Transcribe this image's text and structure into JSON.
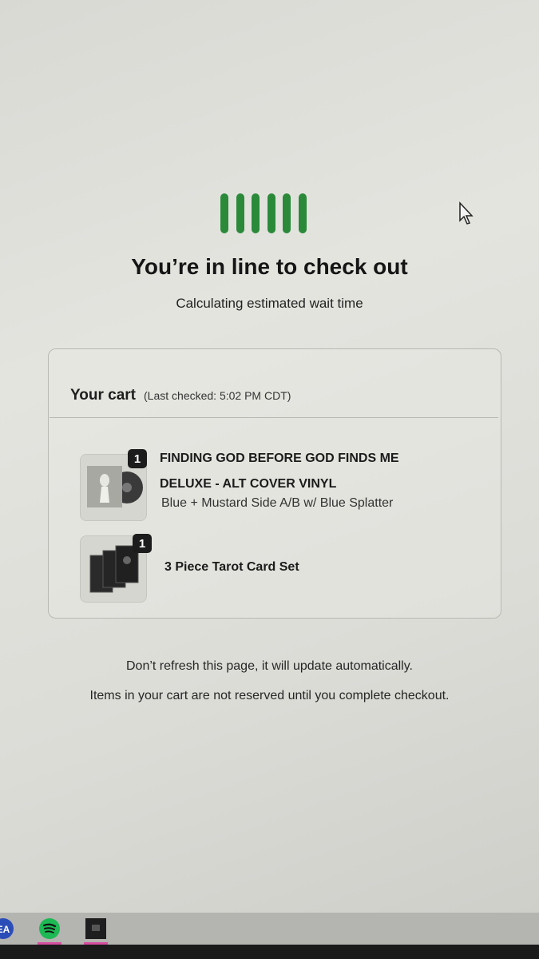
{
  "queue": {
    "title": "You’re in line to check out",
    "subtitle": "Calculating estimated wait time",
    "accent_color": "#2a8a3a",
    "icon": "queue-bars-icon"
  },
  "cart": {
    "title": "Your cart",
    "last_checked": "(Last checked: 5:02 PM CDT)",
    "items": [
      {
        "quantity": "1",
        "name_line1": "FINDING GOD BEFORE GOD FINDS ME",
        "name_line2": "DELUXE - ALT COVER VINYL",
        "variant": "Blue + Mustard Side A/B w/ Blue Splatter",
        "image": "vinyl-album-thumbnail"
      },
      {
        "quantity": "1",
        "name_line1": "3 Piece Tarot Card Set",
        "image": "tarot-card-set-thumbnail"
      }
    ]
  },
  "notices": {
    "refresh": "Don’t refresh this page, it will update automatically.",
    "reserve": "Items in your cart are not reserved until you complete checkout."
  },
  "taskbar": {
    "apps": [
      "ea-app-icon",
      "spotify-icon",
      "window-app-icon"
    ]
  }
}
